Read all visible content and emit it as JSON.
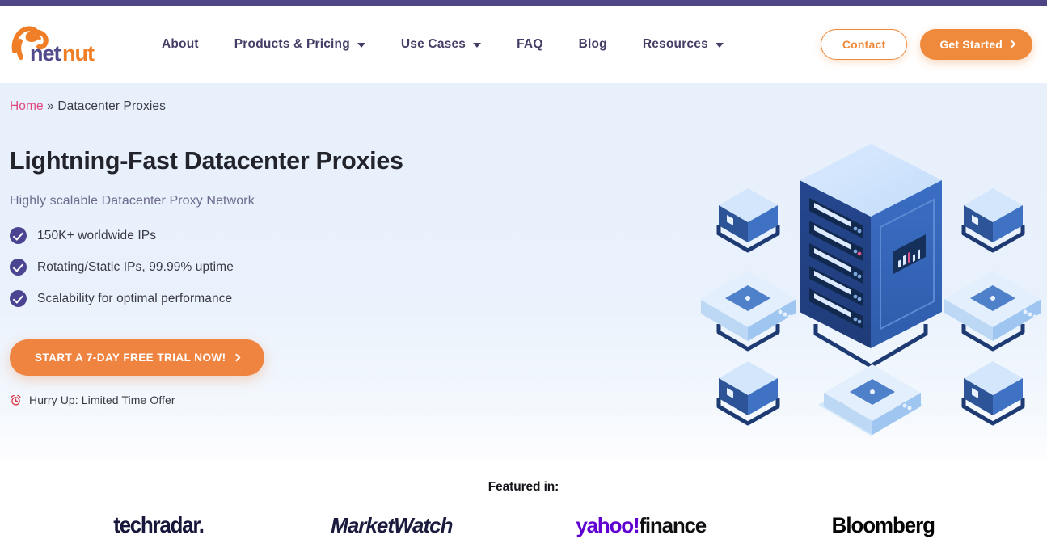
{
  "brand": {
    "logo_text_part1": "net",
    "logo_text_part2": "nut",
    "logo_name": "netnut-logo"
  },
  "colors": {
    "topbar_purple": "#4E4585",
    "accent_orange": "#EF8A3C",
    "nav_purple": "#463D66",
    "breadcrumb_pink": "#E0477E",
    "check_purple": "#4B4490",
    "hero_bg": "#E8F1FC",
    "yahoo_purple": "#6001D2"
  },
  "nav": {
    "items": [
      {
        "label": "About",
        "has_dropdown": false
      },
      {
        "label": "Products & Pricing",
        "has_dropdown": true
      },
      {
        "label": "Use Cases",
        "has_dropdown": true
      },
      {
        "label": "FAQ",
        "has_dropdown": false
      },
      {
        "label": "Blog",
        "has_dropdown": false
      },
      {
        "label": "Resources",
        "has_dropdown": true
      }
    ],
    "contact_label": "Contact",
    "get_started_label": "Get Started"
  },
  "breadcrumb": {
    "home": "Home",
    "separator": "»",
    "current": "Datacenter Proxies"
  },
  "hero": {
    "title": "Lightning-Fast Datacenter Proxies",
    "subtitle": "Highly scalable Datacenter Proxy Network",
    "features": [
      "150K+ worldwide IPs",
      "Rotating/Static IPs, 99.99% uptime",
      "Scalability for optimal performance"
    ],
    "cta_label": "START A 7-DAY FREE TRIAL NOW!",
    "urgency_text": "Hurry Up: Limited Time Offer",
    "illustration_name": "isometric-datacenter-server-network"
  },
  "featured": {
    "title": "Featured in:",
    "brands": [
      {
        "name": "techradar",
        "text": "techradar."
      },
      {
        "name": "marketwatch",
        "text": "MarketWatch"
      },
      {
        "name": "yahoo-finance",
        "text_part1": "yahoo!",
        "text_part2": "finance"
      },
      {
        "name": "bloomberg",
        "text": "Bloomberg"
      }
    ]
  }
}
